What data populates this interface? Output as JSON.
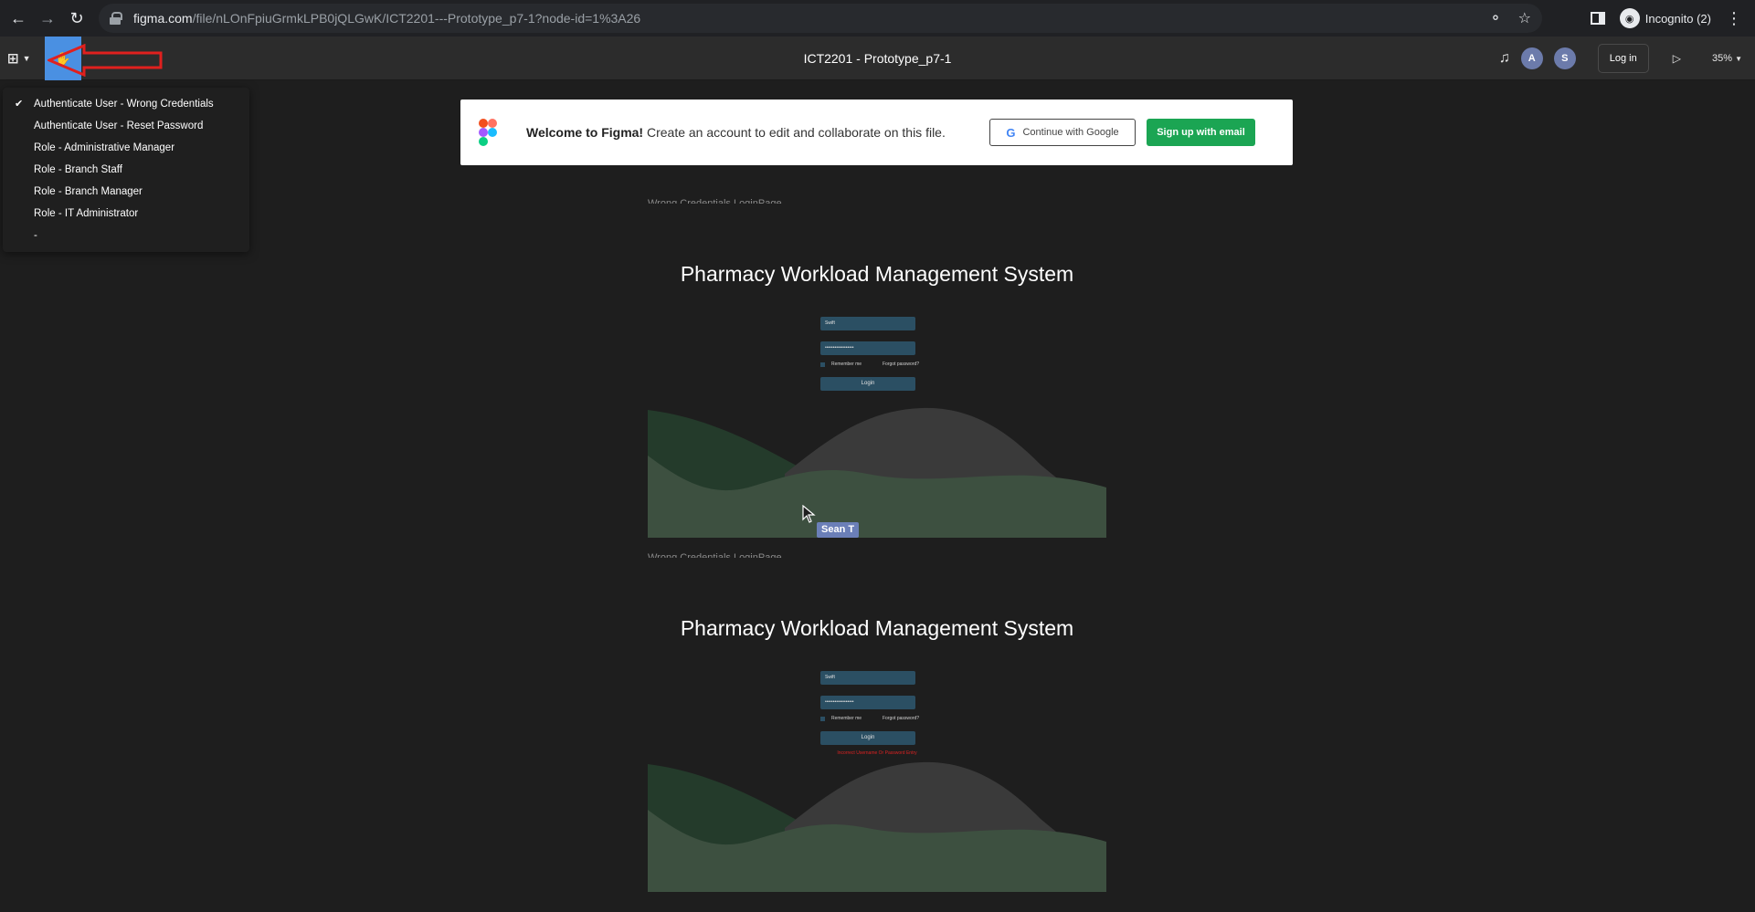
{
  "browser": {
    "url_host": "figma.com",
    "url_path": "/file/nLOnFpiuGrmkLPB0jQLGwK/ICT2201---Prototype_p7-1?node-id=1%3A26",
    "profile_label": "Incognito (2)"
  },
  "figma": {
    "doc_title": "ICT2201 - Prototype_p7-1",
    "avatars": [
      {
        "letter": "A",
        "color": "#6c7bab"
      },
      {
        "letter": "S",
        "color": "#6c7bab"
      }
    ],
    "login_label": "Log in",
    "zoom_label": "35%"
  },
  "flows": {
    "items": [
      {
        "label": "Authenticate User - Wrong Credentials",
        "checked": true
      },
      {
        "label": "Authenticate User - Reset Password",
        "checked": false
      },
      {
        "label": "Role - Administrative Manager",
        "checked": false
      },
      {
        "label": "Role - Branch Staff",
        "checked": false
      },
      {
        "label": "Role - Branch Manager",
        "checked": false
      },
      {
        "label": "Role - IT Administrator",
        "checked": false
      },
      {
        "label": "-",
        "checked": false
      }
    ]
  },
  "welcome": {
    "bold": "Welcome to Figma!",
    "text": " Create an account to edit and collaborate on this file.",
    "google_label": "Continue with Google",
    "signup_label": "Sign up with email"
  },
  "frames": [
    {
      "label": "Wrong Credentials LoginPage",
      "title": "Pharmacy Workload Management System",
      "username": "Swift",
      "password": "••••••••••••••••••",
      "remember": "Remember me",
      "forgot": "Forgot password?",
      "login": "Login",
      "error": ""
    },
    {
      "label": "Wrong Credentials LoginPage",
      "title": "Pharmacy Workload Management System",
      "username": "Swift",
      "password": "••••••••••••••••••",
      "remember": "Remember me",
      "forgot": "Forgot password?",
      "login": "Login",
      "error": "Incorrect Username Or Password Entry"
    }
  ],
  "cursor": {
    "name": "Sean T"
  },
  "colors": {
    "flow_tile": "#4a90e2",
    "signup": "#1ba553",
    "wave_green": "#2a3d30",
    "wave_grey": "#3c3c3c",
    "input": "#2b4f63"
  }
}
